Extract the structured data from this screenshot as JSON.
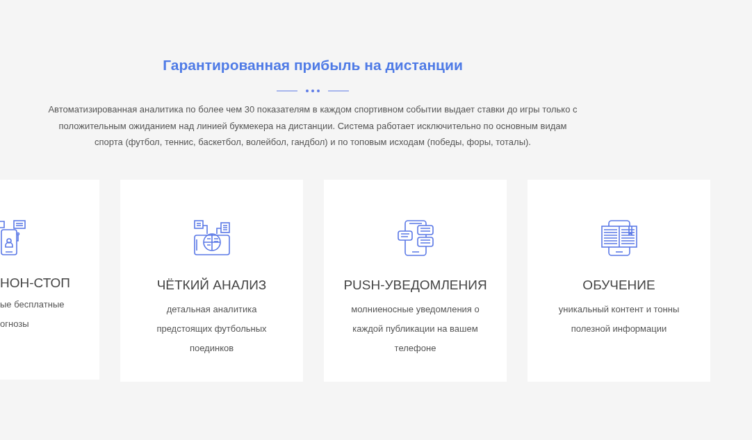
{
  "section": {
    "title": "Гарантированная прибыль на дистанции",
    "description": "Автоматизированная аналитика по более чем 30 показателям в каждом спортивном событии выдает ставки до игры только с положительным ожиданием над линией букмекера на дистанции. Система работает исключительно по основным видам спорта (футбол, теннис, баскетбол, волейбол, гандбол) и по топовым исходам (победы, форы, тоталы)."
  },
  "features": [
    {
      "kind": "clipped",
      "title": "НОН-СТОП",
      "lines": [
        "ые бесплатные",
        "огнозы"
      ]
    },
    {
      "kind": "full",
      "title": "ЧЁТКИЙ АНАЛИЗ",
      "description": "детальная аналитика предстоящих футбольных поединков"
    },
    {
      "kind": "full",
      "title": "PUSH-УВЕДОМЛЕНИЯ",
      "description": "молниеносные уведомления о каждой публикации на вашем телефоне"
    },
    {
      "kind": "full",
      "title": "ОБУЧЕНИЕ",
      "description": "уникальный контент и тонны полезной информации"
    }
  ]
}
